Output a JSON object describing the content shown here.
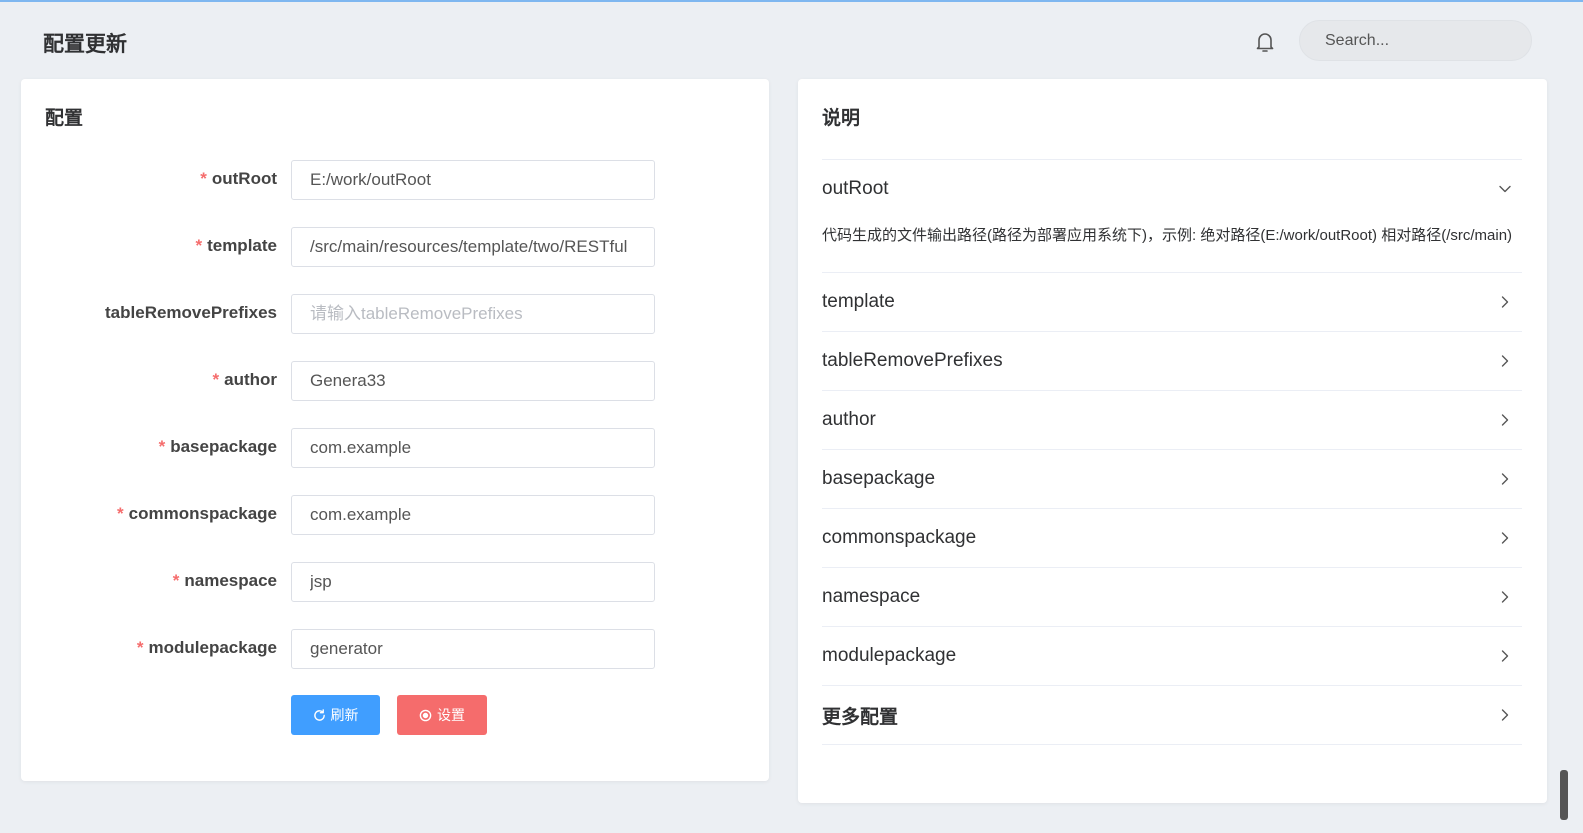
{
  "header": {
    "title": "配置更新",
    "search_placeholder": "Search..."
  },
  "config_card": {
    "title": "配置",
    "fields": [
      {
        "label": "outRoot",
        "required": true,
        "value": "E:/work/outRoot",
        "placeholder": ""
      },
      {
        "label": "template",
        "required": true,
        "value": "/src/main/resources/template/two/RESTful",
        "placeholder": ""
      },
      {
        "label": "tableRemovePrefixes",
        "required": false,
        "value": "",
        "placeholder": "请输入tableRemovePrefixes"
      },
      {
        "label": "author",
        "required": true,
        "value": "Genera33",
        "placeholder": ""
      },
      {
        "label": "basepackage",
        "required": true,
        "value": "com.example",
        "placeholder": ""
      },
      {
        "label": "commonspackage",
        "required": true,
        "value": "com.example",
        "placeholder": ""
      },
      {
        "label": "namespace",
        "required": true,
        "value": "jsp",
        "placeholder": ""
      },
      {
        "label": "modulepackage",
        "required": true,
        "value": "generator",
        "placeholder": ""
      }
    ],
    "required_mark": "*",
    "refresh_label": "刷新",
    "settings_label": "设置"
  },
  "help_card": {
    "title": "说明",
    "items": [
      {
        "title": "outRoot",
        "expanded": true,
        "content": "代码生成的文件输出路径(路径为部署应用系统下)，示例: 绝对路径(E:/work/outRoot) 相对路径(/src/main)"
      },
      {
        "title": "template",
        "expanded": false
      },
      {
        "title": "tableRemovePrefixes",
        "expanded": false
      },
      {
        "title": "author",
        "expanded": false
      },
      {
        "title": "basepackage",
        "expanded": false
      },
      {
        "title": "commonspackage",
        "expanded": false
      },
      {
        "title": "namespace",
        "expanded": false
      },
      {
        "title": "modulepackage",
        "expanded": false
      },
      {
        "title": "更多配置",
        "expanded": false
      }
    ]
  },
  "colors": {
    "primary": "#409eff",
    "danger": "#f56c6c",
    "background": "#eceff3"
  }
}
